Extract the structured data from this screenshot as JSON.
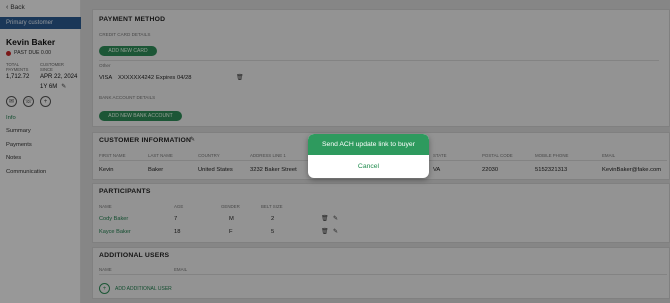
{
  "sidebar": {
    "back_label": "Back",
    "primary_label": "Primary customer",
    "customer_name": "Kevin Baker",
    "past_due": "PAST DUE 0.00",
    "total_payments_label": "TOTAL PAYMENTS",
    "total_payments_value": "1,712.72",
    "customer_since_label": "CUSTOMER SINCE",
    "customer_since_value": "APR 22, 2024",
    "tenure": "1Y 6M",
    "nav": [
      "Info",
      "Summary",
      "Payments",
      "Notes",
      "Communication"
    ]
  },
  "payment_method": {
    "title": "PAYMENT METHOD",
    "credit_card_label": "CREDIT CARD DETAILS",
    "add_card_label": "ADD NEW CARD",
    "other_label": "Other",
    "card_brand": "VISA",
    "card_number": "XXXXXX4242",
    "card_expiry": "Expires 04/28",
    "bank_label": "BANK ACCOUNT DETAILS",
    "add_bank_label": "ADD NEW BANK ACCOUNT"
  },
  "customer_info": {
    "title": "CUSTOMER INFORMATION",
    "headers": [
      "FIRST NAME",
      "LAST NAME",
      "COUNTRY",
      "ADDRESS LINE 1",
      "STATE",
      "POSTAL CODE",
      "MOBILE PHONE",
      "EMAIL"
    ],
    "values": [
      "Kevin",
      "Baker",
      "United States",
      "3232 Baker Street",
      "VA",
      "22030",
      "5152321313",
      "KevinBaker@fake.com"
    ]
  },
  "participants": {
    "title": "PARTICIPANTS",
    "headers": [
      "NAME",
      "AGE",
      "GENDER",
      "BELT SIZE"
    ],
    "rows": [
      {
        "name": "Cody Baker",
        "age": "7",
        "gender": "M",
        "belt": "2"
      },
      {
        "name": "Kayce Baker",
        "age": "18",
        "gender": "F",
        "belt": "5"
      }
    ]
  },
  "additional_users": {
    "title": "ADDITIONAL USERS",
    "headers": [
      "NAME",
      "EMAIL"
    ],
    "add_label": "ADD ADDITIONAL USER"
  },
  "popup": {
    "primary_label": "Send ACH update link to buyer",
    "cancel_label": "Cancel"
  },
  "colors": {
    "accent_green": "#2e9a5e",
    "sidebar_primary": "#2a5a8f",
    "past_due_dot": "#c62828"
  }
}
